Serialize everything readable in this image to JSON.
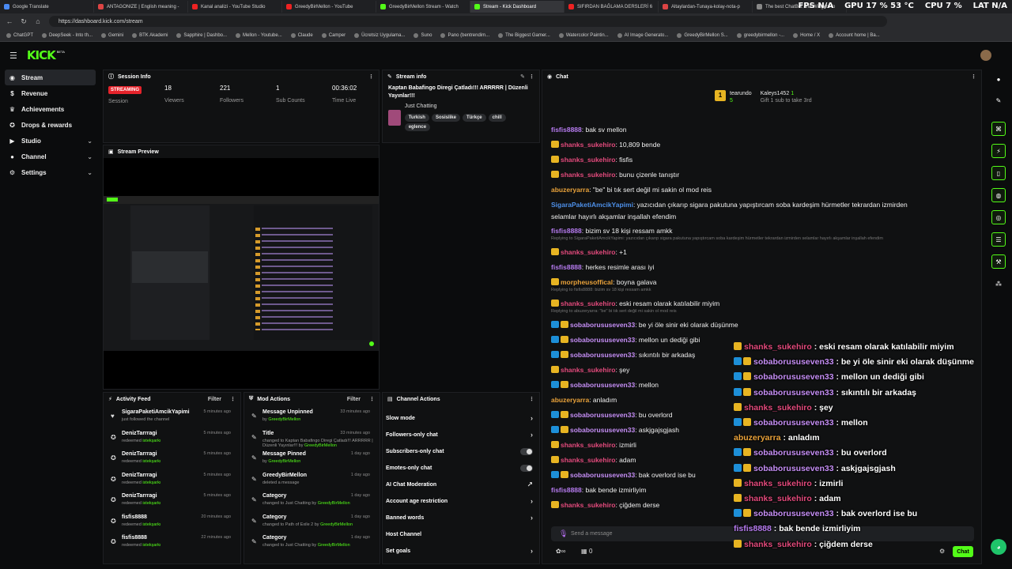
{
  "browser": {
    "tabs": [
      "Google Translate",
      "ANTAGONIZE | English meaning -",
      "Kanal analizi - YouTube Studio",
      "GreedyBirMellon - YouTube",
      "GreedyBirMellon Stream - Watch",
      "Stream - Kick Dashboard",
      "SIFIRDAN BAĞLAMA DERSLERİ 6",
      "Altaylardan-Tunaya-kolay-nota-p",
      "The best ChatBot and Widgets fo"
    ],
    "url": "https://dashboard.kick.com/stream",
    "bookmarks": [
      "ChatGPT",
      "DeepSeek - Into th...",
      "Gemini",
      "BTK Akademi",
      "Sapphire | Dashbo...",
      "Mellon - Youtube...",
      "Claude",
      "Camper",
      "Ücretsiz Uygulama...",
      "Suno",
      "Pano (bentrendim...",
      "The Biggest Gamer...",
      "Watercolor Paintin...",
      "AI Image Generato...",
      "GreedyBirMellon S...",
      "greedybirmellon -...",
      "Home / X",
      "Account home | Ba..."
    ],
    "stats": {
      "fps": "FPS N/A",
      "gpu": "GPU 17 % 53 °C",
      "cpu": "CPU 7 %",
      "lat": "LAT N/A"
    }
  },
  "app": {
    "logo": "KICK",
    "beta": "BETA"
  },
  "sidebar": {
    "items": [
      {
        "label": "Stream",
        "icon": "broadcast-icon"
      },
      {
        "label": "Revenue",
        "icon": "dollar-icon"
      },
      {
        "label": "Achievements",
        "icon": "trophy-icon"
      },
      {
        "label": "Drops & rewards",
        "icon": "gift-icon"
      },
      {
        "label": "Studio",
        "icon": "film-icon"
      },
      {
        "label": "Channel",
        "icon": "user-icon"
      },
      {
        "label": "Settings",
        "icon": "gear-icon"
      }
    ]
  },
  "session": {
    "title": "Session Info",
    "status": "STREAMING",
    "status_label": "Session",
    "stats": [
      {
        "value": "18",
        "label": "Viewers"
      },
      {
        "value": "221",
        "label": "Followers"
      },
      {
        "value": "1",
        "label": "Sub Counts"
      },
      {
        "value": "00:36:02",
        "label": "Time Live"
      }
    ]
  },
  "streaminfo": {
    "title_label": "Stream info",
    "stream_title": "Kaptan Babafingo Diregi Çatladı!!! ARRRRR | Düzenli Yayınlar!!!",
    "category": "Just Chatting",
    "tags": [
      "Turkish",
      "Sosislike",
      "Türkçe",
      "chill",
      "eglence"
    ]
  },
  "preview": {
    "title": "Stream Preview"
  },
  "activity": {
    "title": "Activity Feed",
    "filter": "Filter",
    "rows": [
      {
        "name": "SigaraPaketiAmcikYapimi",
        "sub": "just followed the channel",
        "green": "",
        "time": "5 minutes ago"
      },
      {
        "name": "DenizTarrragi",
        "sub": "redeemed",
        "green": "istekşarkı",
        "time": "5 minutes ago"
      },
      {
        "name": "DenizTarrragi",
        "sub": "redeemed",
        "green": "istekşarkı",
        "time": "5 minutes ago"
      },
      {
        "name": "DenizTarrragi",
        "sub": "redeemed",
        "green": "istekşarkı",
        "time": "5 minutes ago"
      },
      {
        "name": "DenizTarrragi",
        "sub": "redeemed",
        "green": "istekşarkı",
        "time": "5 minutes ago"
      },
      {
        "name": "fisfis8888",
        "sub": "redeemed",
        "green": "istekşarkı",
        "time": "20 minutes ago"
      },
      {
        "name": "fisfis8888",
        "sub": "redeemed",
        "green": "istekşarkı",
        "time": "22 minutes ago"
      }
    ]
  },
  "modactions": {
    "title": "Mod Actions",
    "filter": "Filter",
    "rows": [
      {
        "name": "Message Unpinned",
        "sub": "by",
        "green": "GreedyBirMellon",
        "time": "33 minutes ago"
      },
      {
        "name": "Title",
        "sub": "changed to Kaptan Babafingo Diregi Çatladı!!! ARRRRR | Düzenli Yayınlar!!! by",
        "green": "GreedyBirMellon",
        "time": "33 minutes ago"
      },
      {
        "name": "Message Pinned",
        "sub": "by",
        "green": "GreedyBirMellon",
        "time": "1 day ago"
      },
      {
        "name": "GreedyBirMellon",
        "sub": "deleted a message",
        "green": "",
        "time": "1 day ago"
      },
      {
        "name": "Category",
        "sub": "changed to Just Chatting by",
        "green": "GreedyBirMellon",
        "time": "1 day ago"
      },
      {
        "name": "Category",
        "sub": "changed to Path of Exile 2 by",
        "green": "GreedyBirMellon",
        "time": "1 day ago"
      },
      {
        "name": "Category",
        "sub": "changed to Just Chatting by",
        "green": "GreedyBirMellon",
        "time": "1 day ago"
      }
    ]
  },
  "channelactions": {
    "title": "Channel Actions",
    "rows": [
      {
        "label": "Slow mode",
        "kind": "arrow"
      },
      {
        "label": "Followers-only chat",
        "kind": "arrow"
      },
      {
        "label": "Subscribers-only chat",
        "kind": "toggle"
      },
      {
        "label": "Emotes-only chat",
        "kind": "toggle"
      },
      {
        "label": "AI Chat Moderation",
        "kind": "ext"
      },
      {
        "label": "Account age restriction",
        "kind": "arrow"
      },
      {
        "label": "Banned words",
        "kind": "arrow"
      },
      {
        "label": "Host Channel",
        "kind": "none"
      },
      {
        "label": "Set goals",
        "kind": "arrow"
      }
    ]
  },
  "chat": {
    "title": "Chat",
    "gift": {
      "user1": "tearundo",
      "count1": "5",
      "user2": "Kaleys1452",
      "count2": "1",
      "note": "Gift 1 sub to take 3rd"
    },
    "placeholder": "Send a message",
    "send": "Chat",
    "points": "0"
  },
  "chatmsgs": [
    {
      "user": "fisfis8888",
      "text": ": bak sv mellon",
      "c": "cyan",
      "b": ""
    },
    {
      "user": "shanks_sukehiro",
      "text": ": 10,809 bende",
      "c": "pink",
      "b": "crown"
    },
    {
      "user": "shanks_sukehiro",
      "text": ": fisfis",
      "c": "pink",
      "b": "crown"
    },
    {
      "user": "shanks_sukehiro",
      "text": ": bunu çizenle tanıştır",
      "c": "pink",
      "b": "crown"
    },
    {
      "user": "abuzeryarra",
      "text": ": \"be\" bi tık sert değil mi sakin ol mod reis",
      "c": "orange",
      "b": ""
    },
    {
      "user": "SigaraPaketiAmcikYapimi",
      "text": ": yazıcıdan çıkarıp sigara pakutuna yapıştırcam soba kardeşim hürmetler tekrardan izmirden",
      "c": "blue",
      "b": ""
    },
    {
      "user": "",
      "text": "selamlar hayırlı akşamlar inşallah efendim",
      "c": "blue",
      "b": ""
    },
    {
      "user": "fisfis8888",
      "text": ": bizim sv 18 kişi ressam amkk",
      "c": "cyan",
      "b": ""
    },
    {
      "user": "shanks_sukehiro",
      "text": ": +1",
      "c": "pink",
      "b": "crown"
    },
    {
      "user": "fisfis8888",
      "text": ": herkes resimle arası iyi",
      "c": "cyan",
      "b": ""
    },
    {
      "user": "morpheusoffical",
      "text": ": boyna galava",
      "c": "orange",
      "b": "crown"
    },
    {
      "user": "shanks_sukehiro",
      "text": ": eski resam olarak katılabilir miyim",
      "c": "pink",
      "b": "crown"
    },
    {
      "user": "sobaborususeven33",
      "text": ": be yi öle sinir eki olarak düşünme",
      "c": "purp",
      "b": "both"
    },
    {
      "user": "sobaborususeven33",
      "text": ": mellon un dediği gibi",
      "c": "purp",
      "b": "both"
    },
    {
      "user": "sobaborususeven33",
      "text": ": sıkıntılı bir arkadaş",
      "c": "purp",
      "b": "both"
    },
    {
      "user": "shanks_sukehiro",
      "text": ": şey",
      "c": "pink",
      "b": "crown"
    },
    {
      "user": "sobaborususeven33",
      "text": ": mellon",
      "c": "purp",
      "b": "both"
    },
    {
      "user": "abuzeryarra",
      "text": ": anladım",
      "c": "orange",
      "b": ""
    },
    {
      "user": "sobaborususeven33",
      "text": ": bu overlord",
      "c": "purp",
      "b": "both"
    },
    {
      "user": "sobaborususeven33",
      "text": ": askjgajsgjash",
      "c": "purp",
      "b": "both"
    },
    {
      "user": "shanks_sukehiro",
      "text": ": izmirli",
      "c": "pink",
      "b": "crown"
    },
    {
      "user": "shanks_sukehiro",
      "text": ": adam",
      "c": "pink",
      "b": "crown"
    },
    {
      "user": "sobaborususeven33",
      "text": ": bak overlord ise bu",
      "c": "purp",
      "b": "both"
    },
    {
      "user": "fisfis8888",
      "text": ": bak bende izmirliyim",
      "c": "cyan",
      "b": ""
    },
    {
      "user": "shanks_sukehiro",
      "text": ": çiğdem derse",
      "c": "pink",
      "b": "crown"
    }
  ],
  "replies": [
    "Replying to SigaraPaketiAmcikYapimi: yazıcıdan çıkarıp sigara pakutuna yapıştırcam soba kardeşim hürmetler tekrardan izmirden selamlar hayırlı akşamlar inşallah efendim",
    "Replying to fisfis8888: bizim sv 18 kişi ressam amkk",
    "Replying to abuzeryarra: \"be\" bi tık sert değil mi sakin ol mod reis"
  ],
  "overlay": [
    {
      "user": "shanks_sukehiro",
      "text": " : eski resam olarak katılabilir miyim",
      "c": "pink",
      "b": "crown"
    },
    {
      "user": "sobaborususeven33",
      "text": " : be yi öle sinir eki olarak düşünme",
      "c": "purp",
      "b": "both"
    },
    {
      "user": "sobaborususeven33",
      "text": " : mellon un dediği gibi",
      "c": "purp",
      "b": "both"
    },
    {
      "user": "sobaborususeven33",
      "text": " : sıkıntılı bir arkadaş",
      "c": "purp",
      "b": "both"
    },
    {
      "user": "shanks_sukehiro",
      "text": " : şey",
      "c": "pink",
      "b": "crown"
    },
    {
      "user": "sobaborususeven33",
      "text": " : mellon",
      "c": "purp",
      "b": "both"
    },
    {
      "user": "abuzeryarra",
      "text": " : anladım",
      "c": "orange",
      "b": ""
    },
    {
      "user": "sobaborususeven33",
      "text": " : bu overlord",
      "c": "purp",
      "b": "both"
    },
    {
      "user": "sobaborususeven33",
      "text": " : askjgajsgjash",
      "c": "purp",
      "b": "both"
    },
    {
      "user": "shanks_sukehiro",
      "text": " : izmirli",
      "c": "pink",
      "b": "crown"
    },
    {
      "user": "shanks_sukehiro",
      "text": " : adam",
      "c": "pink",
      "b": "crown"
    },
    {
      "user": "sobaborususeven33",
      "text": " : bak overlord ise bu",
      "c": "purp",
      "b": "both"
    },
    {
      "user": "fisfis8888",
      "text": " : bak bende izmirliyim",
      "c": "cyan",
      "b": ""
    },
    {
      "user": "shanks_sukehiro",
      "text": " : çiğdem derse",
      "c": "pink",
      "b": "crown"
    }
  ],
  "colors": {
    "accent": "#53fc18",
    "live": "#e5232b"
  }
}
